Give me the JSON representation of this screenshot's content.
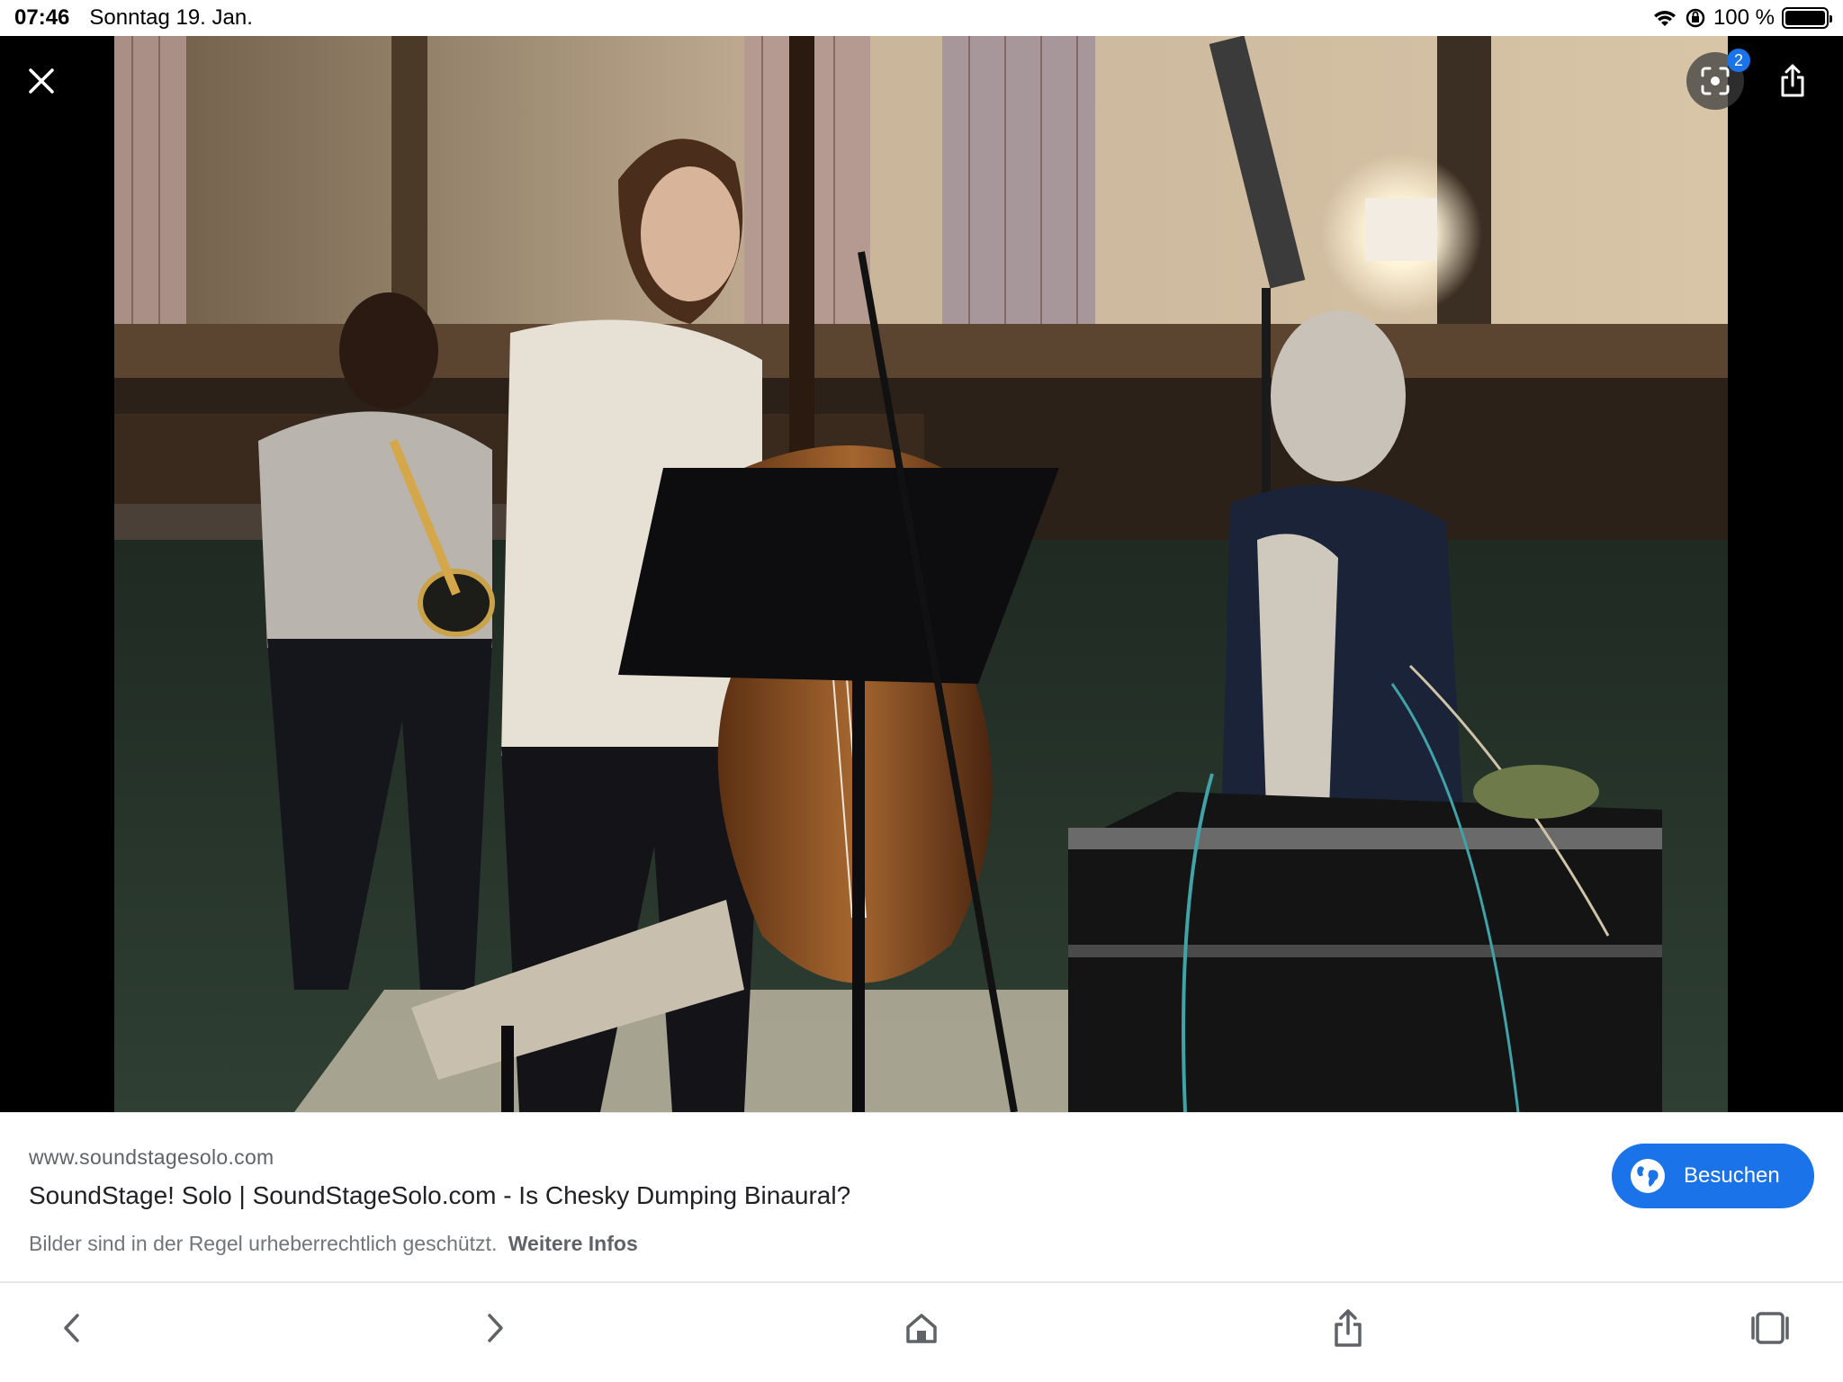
{
  "status_bar": {
    "time": "07:46",
    "date": "Sonntag 19. Jan.",
    "battery": "100 %",
    "icons": [
      "wifi-icon",
      "orientation-lock-icon",
      "battery-icon"
    ]
  },
  "viewer": {
    "image_alt": "SoundStage! Solo | SoundStageSolo.com - Is Chesky Dumping Binaural?",
    "lens_badge": "2",
    "icons": [
      "close-icon",
      "lens-icon",
      "share-icon"
    ]
  },
  "result": {
    "domain": "www.soundstagesolo.com",
    "title": "SoundStage! Solo | SoundStageSolo.com - Is Chesky Dumping Binaural?",
    "copyright": "Bilder sind in der Regel urheberrechtlich geschützt.",
    "more_info": "Weitere Infos",
    "visit_label": "Besuchen"
  },
  "toolbar": {
    "icons": [
      "back-icon",
      "forward-icon",
      "home-icon",
      "share-icon",
      "tabs-icon"
    ]
  },
  "colors": {
    "accent": "#1a73e8",
    "viewer_bg": "#000000"
  }
}
